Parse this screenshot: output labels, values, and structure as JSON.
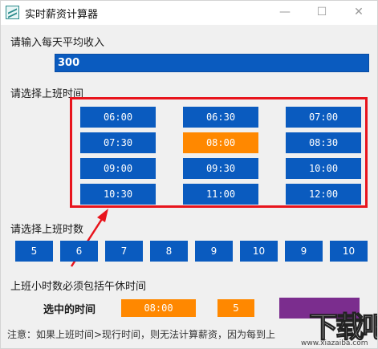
{
  "window": {
    "title": "实时薪资计算器",
    "controls": {
      "minimize": "—",
      "maximize": "☐",
      "close": "✕"
    }
  },
  "income": {
    "label": "请输入每天平均收入",
    "value": "300"
  },
  "start_time": {
    "label": "请选择上班时间",
    "options": [
      "06:00",
      "06:30",
      "07:00",
      "07:30",
      "08:00",
      "08:30",
      "09:00",
      "09:30",
      "10:00",
      "10:30",
      "11:00",
      "12:00"
    ],
    "selected": "08:00"
  },
  "work_hours": {
    "label": "请选择上班时数",
    "options": [
      "5",
      "6",
      "7",
      "8",
      "9",
      "10",
      "9",
      "10"
    ],
    "note": "上班小时数必须包括午休时间"
  },
  "selection": {
    "label": "选中的时间",
    "time": "08:00",
    "hours": "5"
  },
  "footer_note": "注意：如果上班时间>现行时间，则无法计算薪资，因为每到上",
  "annotation_color": "#e8141c",
  "colors": {
    "button_blue": "#0a5bbf",
    "selected_orange": "#ff8800",
    "calc_purple": "#7b2d8e"
  },
  "watermark": {
    "text": "下载吧",
    "sub": "www.xiazaiba.com"
  }
}
